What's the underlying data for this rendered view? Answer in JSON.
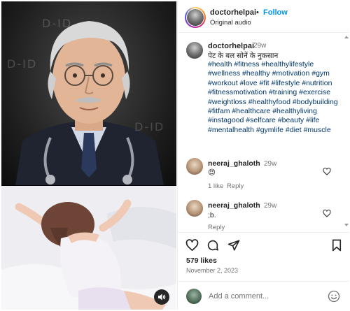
{
  "header": {
    "username": "doctorhelpai",
    "separator": "•",
    "follow_label": "Follow",
    "subtitle": "Original audio"
  },
  "caption": {
    "username": "doctorhelpai",
    "time": "29w",
    "text": "पेट के बल सोनें के नुकसान",
    "hashtags": "#health #fitness #healthylifestyle #wellness #healthy #motivation #gym #workout #love #fit #lifestyle #nutrition #fitnessmotivation #training #exercise #weightloss #healthyfood #bodybuilding #fitfam #healthcare #healthyliving #instagood #selfcare #beauty #life #mentalhealth #gymlife #diet #muscle"
  },
  "comments": [
    {
      "username": "neeraj_ghaloth",
      "time": "29w",
      "text": "😍",
      "likes": "1 like",
      "reply": "Reply"
    },
    {
      "username": "neeraj_ghaloth",
      "time": "29w",
      "text": ";b.",
      "likes": "",
      "reply": "Reply"
    }
  ],
  "post": {
    "likes": "579 likes",
    "date": "November 2, 2023"
  },
  "add_comment": {
    "placeholder": "Add a comment..."
  },
  "media": {
    "watermark": "D-ID"
  },
  "icons": {
    "like": "heart-icon",
    "comment": "comment-icon",
    "share": "share-icon",
    "save": "bookmark-icon",
    "audio": "speaker-icon",
    "emoji": "emoji-icon"
  },
  "colors": {
    "link": "#0095f6",
    "hashtag": "#00376b",
    "muted": "#737373"
  }
}
